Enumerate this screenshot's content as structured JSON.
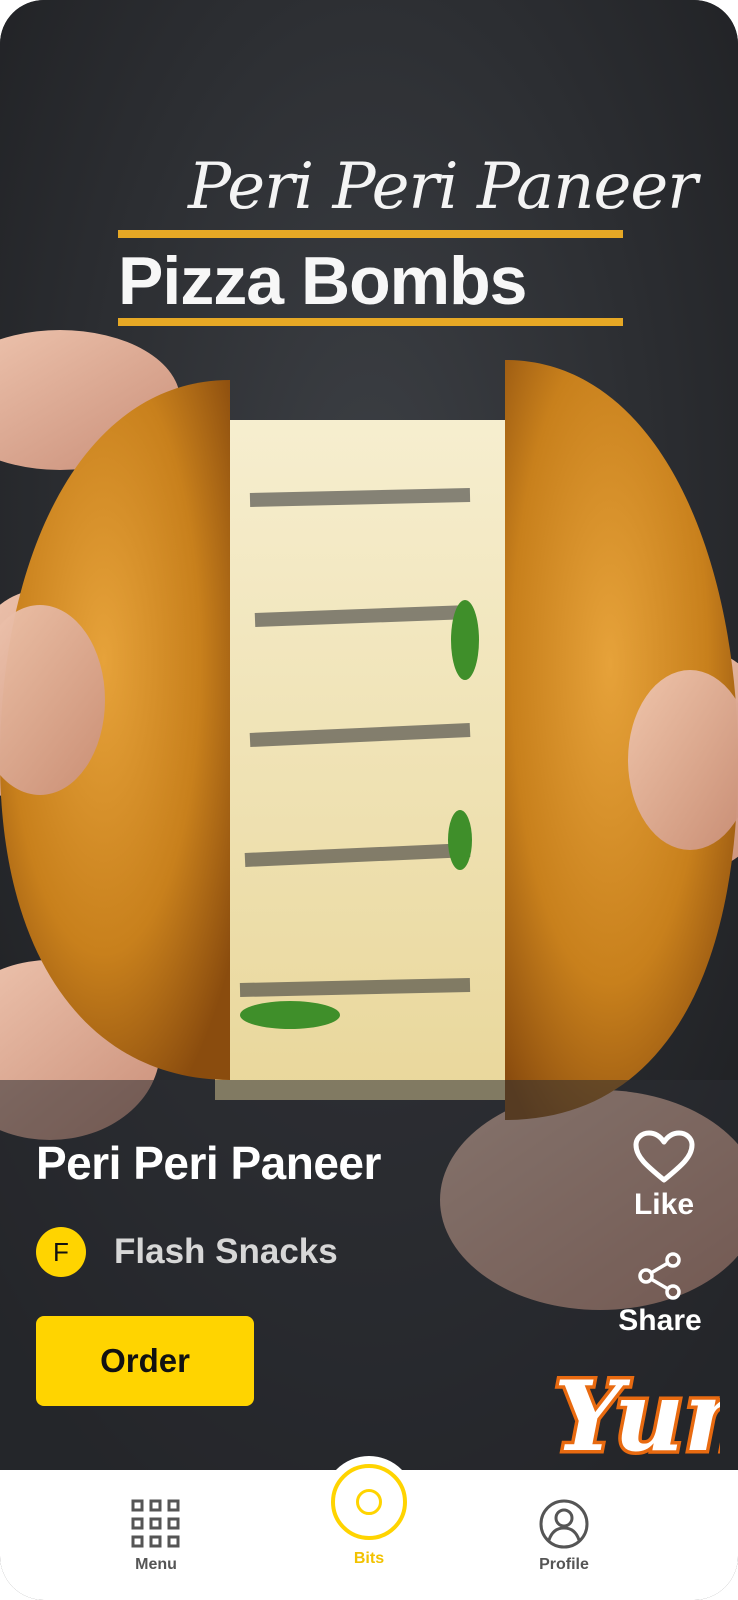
{
  "video": {
    "overlay_title_script": "Peri Peri Paneer",
    "overlay_title_bold": "Pizza Bombs",
    "watermark_text": "Yum"
  },
  "item": {
    "title": "Peri Peri Paneer",
    "shop_initial": "F",
    "shop_name": "Flash Snacks",
    "order_label": "Order"
  },
  "actions": {
    "like_label": "Like",
    "like_icon": "heart-icon",
    "share_label": "Share",
    "share_icon": "share-icon"
  },
  "navbar": {
    "items": [
      {
        "label": "Menu",
        "icon": "grid-icon",
        "active": false
      },
      {
        "label": "Bits",
        "icon": "bits-icon",
        "active": true
      },
      {
        "label": "Profile",
        "icon": "user-icon",
        "active": false
      }
    ]
  },
  "colors": {
    "accent": "#ffd400",
    "title_bar": "#e6a825",
    "background": "#2b2d31",
    "navbar_bg": "#ffffff"
  }
}
